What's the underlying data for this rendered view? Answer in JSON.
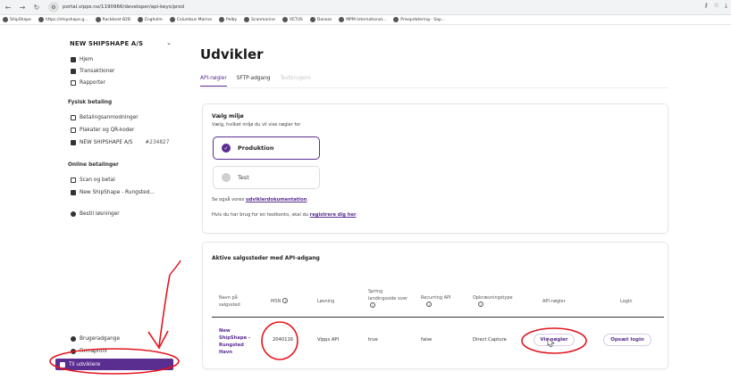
{
  "browser": {
    "url": "portal.vipps.no/1190966/developer/api-keys/prod",
    "bookmarks": [
      "ShipShape",
      "https://shipshape.g...",
      "Rackbeat B2B",
      "Engholm",
      "Columbus Marine",
      "Pelby",
      "Scanmarine",
      "VETUS",
      "Danoss",
      "MPM International...",
      "Prisopdatering - Sap..."
    ]
  },
  "sidebar": {
    "company": "NEW SHIPSHAPE A/S",
    "nav": [
      "Hjem",
      "Transaktioner",
      "Rapporter"
    ],
    "physical_heading": "Fysisk betaling",
    "physical": [
      "Betalingsanmodninger",
      "Plakater og QR-koder",
      "NEW SHIPSHAPE A/S"
    ],
    "physical_extra": "#234827",
    "online_heading": "Online betalinger",
    "online": [
      "Scan og betal",
      "New ShipShape - Rungsted..."
    ],
    "add_new": "Bestil løsninger",
    "bottom": [
      "Brugeradgange",
      "Firmaprofil"
    ],
    "developer": "Til udviklere"
  },
  "main": {
    "title": "Udvikler",
    "tabs": [
      "API-nøgler",
      "SFTP-adgang",
      "Testbrugere"
    ],
    "env": {
      "title": "Vælg miljø",
      "subtitle": "Vælg, hvilket miljø du vil vise nøgler for",
      "options": [
        "Produktion",
        "Test"
      ],
      "note1_prefix": "Se også vores ",
      "note1_link": "udviklerdokumentation",
      "note1_suffix": ".",
      "note2_prefix": "Hvis du har brug for en testkonto, skal du ",
      "note2_link": "registrere dig her",
      "note2_suffix": "."
    },
    "sales": {
      "title": "Aktive salgssteder med API-adgang",
      "headers": [
        "Navn på salgssted",
        "MSN",
        "Løsning",
        "Spring landingsside over",
        "Recurring API",
        "Opkrævningstype",
        "API-nøgler",
        "Login"
      ],
      "row": {
        "name": "New ShipShape - Rungsted Havn",
        "msn": "2040116",
        "solution": "Vipps API",
        "skip_landing": "true",
        "recurring": "false",
        "capture_type": "Direct Capture",
        "keys_btn": "Vis nøgler",
        "login_btn": "Opsæt login"
      }
    }
  },
  "colors": {
    "brand": "#5a2d91",
    "annotation": "#e3151f"
  }
}
